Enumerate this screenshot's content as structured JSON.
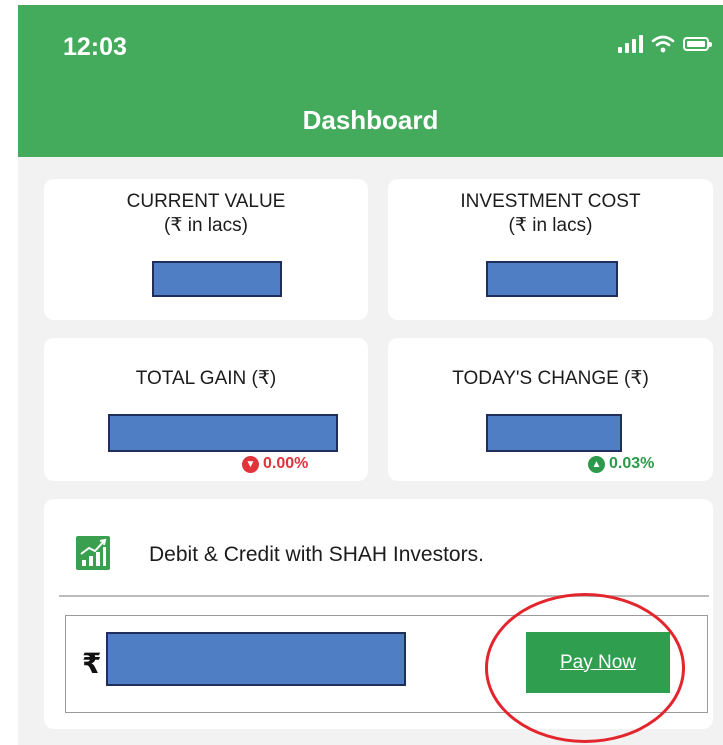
{
  "status_bar": {
    "time": "12:03",
    "icons": [
      "signal-icon",
      "wifi-icon",
      "battery-icon"
    ]
  },
  "header": {
    "title": "Dashboard",
    "background_color": "#45ab5c"
  },
  "cards": {
    "current_value": {
      "label_line1": "CURRENT VALUE",
      "label_line2": "(₹ in lacs)"
    },
    "investment_cost": {
      "label_line1": "INVESTMENT COST",
      "label_line2": "(₹ in lacs)"
    },
    "total_gain": {
      "label": "TOTAL GAIN (₹)",
      "change": "0.00%",
      "change_direction": "down",
      "change_color": "#e0333a"
    },
    "todays_change": {
      "label": "TODAY'S CHANGE (₹)",
      "change": "0.03%",
      "change_direction": "up",
      "change_color": "#2c9a4a"
    }
  },
  "promo": {
    "icon": "growth-chart-icon",
    "text": "Debit & Credit with SHAH Investors."
  },
  "payment": {
    "currency_symbol": "₹",
    "button_label": "Pay Now",
    "button_color": "#2f9e4f"
  },
  "annotation": {
    "highlight_color": "#e3262d",
    "masked_value_color": "#4f7ec4"
  }
}
